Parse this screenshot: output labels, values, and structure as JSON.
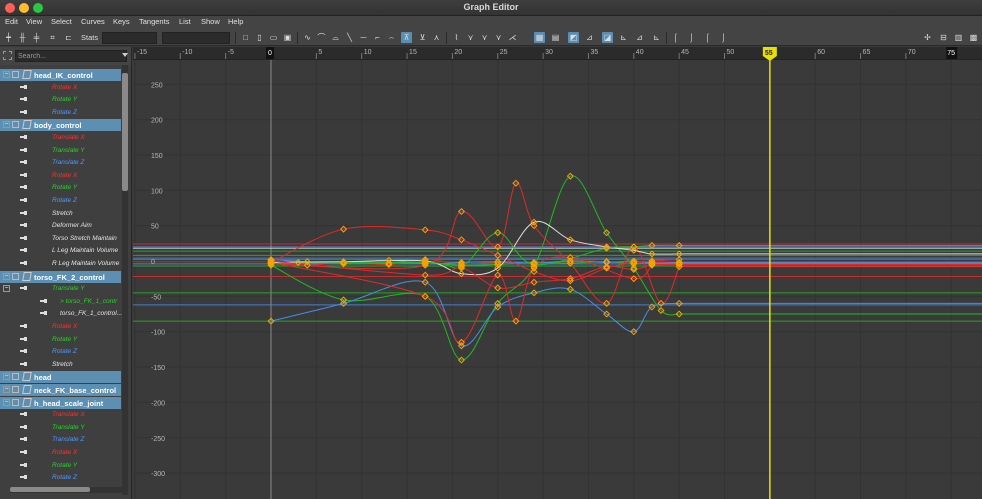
{
  "window": {
    "title": "Graph Editor"
  },
  "menu": [
    "Edit",
    "View",
    "Select",
    "Curves",
    "Keys",
    "Tangents",
    "List",
    "Show",
    "Help"
  ],
  "toolbar": {
    "stats_label": "Stats",
    "stats_value_1": "",
    "stats_value_2": ""
  },
  "outliner": {
    "search_placeholder": "Search...",
    "rows": [
      {
        "type": "node",
        "label": "head_IK_control",
        "selected": true,
        "expanded": true
      },
      {
        "type": "attr",
        "label": "Rotate X",
        "color": "red"
      },
      {
        "type": "attr",
        "label": "Rotate Y",
        "color": "green"
      },
      {
        "type": "attr",
        "label": "Rotate Z",
        "color": "blue"
      },
      {
        "type": "node",
        "label": "body_control",
        "selected": true,
        "expanded": true
      },
      {
        "type": "attr",
        "label": "Translate X",
        "color": "red"
      },
      {
        "type": "attr",
        "label": "Translate Y",
        "color": "green"
      },
      {
        "type": "attr",
        "label": "Translate Z",
        "color": "blue"
      },
      {
        "type": "attr",
        "label": "Rotate X",
        "color": "red"
      },
      {
        "type": "attr",
        "label": "Rotate Y",
        "color": "green"
      },
      {
        "type": "attr",
        "label": "Rotate Z",
        "color": "blue"
      },
      {
        "type": "attr",
        "label": "Stretch",
        "color": "white"
      },
      {
        "type": "attr",
        "label": "Deformer Aim",
        "color": "white"
      },
      {
        "type": "attr",
        "label": "Torso Stretch Maintain",
        "color": "white"
      },
      {
        "type": "attr",
        "label": "L Leg Maintain Volume",
        "color": "white"
      },
      {
        "type": "attr",
        "label": "R Leg Maintain Volume",
        "color": "white"
      },
      {
        "type": "node",
        "label": "torso_FK_2_control",
        "selected": true,
        "expanded": true
      },
      {
        "type": "attr",
        "label": "Translate Y",
        "color": "green",
        "expander": true
      },
      {
        "type": "subattr",
        "label": "> torso_FK_1_contr",
        "color": "green"
      },
      {
        "type": "subattr",
        "label": "torso_FK_1_control...",
        "color": "white"
      },
      {
        "type": "attr",
        "label": "Rotate X",
        "color": "red"
      },
      {
        "type": "attr",
        "label": "Rotate Y",
        "color": "green"
      },
      {
        "type": "attr",
        "label": "Rotate Z",
        "color": "blue"
      },
      {
        "type": "attr",
        "label": "Stretch",
        "color": "white"
      },
      {
        "type": "node",
        "label": "head",
        "selected": true,
        "expanded": true
      },
      {
        "type": "node",
        "label": "neck_FK_base_control",
        "selected": true,
        "expanded": true
      },
      {
        "type": "node",
        "label": "h_head_scale_joint",
        "selected": true,
        "expanded": true
      },
      {
        "type": "attr",
        "label": "Translate X",
        "color": "red"
      },
      {
        "type": "attr",
        "label": "Translate Y",
        "color": "green"
      },
      {
        "type": "attr",
        "label": "Translate Z",
        "color": "blue"
      },
      {
        "type": "attr",
        "label": "Rotate X",
        "color": "red"
      },
      {
        "type": "attr",
        "label": "Rotate Y",
        "color": "green"
      },
      {
        "type": "attr",
        "label": "Rotate Z",
        "color": "blue"
      }
    ]
  },
  "graph": {
    "frame_ticks": [
      "-15",
      "-10",
      "-5",
      "0",
      "5",
      "10",
      "15",
      "20",
      "25",
      "30",
      "35",
      "40",
      "45",
      "50",
      "55",
      "60",
      "65",
      "70",
      "75"
    ],
    "start_frame": "0",
    "current_frame": "55",
    "end_frame": "75",
    "value_ticks": [
      "250",
      "200",
      "150",
      "100",
      "50",
      "0",
      "-50",
      "-100",
      "-150",
      "-200",
      "-250",
      "-300"
    ],
    "curve_colors": {
      "red": "#e02a2a",
      "green": "#22b822",
      "blue": "#4a8ce8",
      "white": "#dddddd",
      "key": "#f5a300",
      "current_time": "#e8e000"
    },
    "curves": [
      {
        "color": "red",
        "keys": [
          [
            0,
            1
          ],
          [
            4,
            -6
          ],
          [
            8,
            -2
          ],
          [
            13,
            -5
          ],
          [
            17,
            2
          ],
          [
            21,
            -4
          ],
          [
            25,
            -2
          ],
          [
            29,
            -4
          ],
          [
            33,
            0
          ],
          [
            37,
            -1
          ],
          [
            40,
            -3
          ],
          [
            42,
            -2
          ],
          [
            45,
            -2
          ]
        ]
      },
      {
        "color": "green",
        "keys": [
          [
            0,
            -3
          ],
          [
            3,
            -2
          ],
          [
            8,
            -4
          ],
          [
            13,
            -3
          ],
          [
            17,
            -3
          ],
          [
            21,
            -6
          ],
          [
            25,
            -5
          ],
          [
            29,
            -2
          ],
          [
            33,
            -3
          ],
          [
            37,
            -1
          ],
          [
            40,
            -4
          ],
          [
            42,
            -3
          ],
          [
            45,
            -3
          ]
        ]
      },
      {
        "color": "blue",
        "keys": [
          [
            0,
            2
          ],
          [
            4,
            -1
          ],
          [
            8,
            -3
          ],
          [
            13,
            1
          ],
          [
            17,
            -4
          ],
          [
            21,
            -2
          ],
          [
            25,
            -1
          ],
          [
            29,
            -3
          ],
          [
            33,
            0
          ],
          [
            37,
            -2
          ],
          [
            40,
            0
          ],
          [
            42,
            -3
          ],
          [
            45,
            -2
          ]
        ]
      },
      {
        "color": "red",
        "keys": [
          [
            0,
            -2
          ],
          [
            8,
            45
          ],
          [
            17,
            44
          ],
          [
            21,
            30
          ],
          [
            25,
            8
          ],
          [
            29,
            -15
          ],
          [
            33,
            -28
          ],
          [
            37,
            -10
          ],
          [
            40,
            -2
          ],
          [
            42,
            0
          ],
          [
            45,
            2
          ]
        ]
      },
      {
        "color": "green",
        "keys": [
          [
            0,
            -6
          ],
          [
            8,
            -55
          ],
          [
            17,
            -50
          ],
          [
            21,
            -140
          ],
          [
            25,
            -60
          ],
          [
            29,
            -8
          ],
          [
            33,
            120
          ],
          [
            37,
            40
          ],
          [
            40,
            -10
          ],
          [
            43,
            -70
          ],
          [
            45,
            -75
          ]
        ]
      },
      {
        "color": "blue",
        "keys": [
          [
            0,
            -85
          ],
          [
            8,
            -60
          ],
          [
            17,
            -30
          ],
          [
            21,
            -120
          ],
          [
            25,
            -65
          ],
          [
            29,
            -45
          ],
          [
            33,
            -40
          ],
          [
            37,
            -75
          ],
          [
            40,
            -100
          ],
          [
            42,
            -65
          ],
          [
            45,
            -60
          ]
        ]
      },
      {
        "color": "red",
        "keys": [
          [
            0,
            -4
          ],
          [
            17,
            -6
          ],
          [
            21,
            70
          ],
          [
            25,
            20
          ],
          [
            27,
            110
          ],
          [
            29,
            50
          ],
          [
            33,
            -3
          ],
          [
            37,
            -60
          ],
          [
            40,
            20
          ],
          [
            43,
            -60
          ],
          [
            45,
            -8
          ]
        ]
      },
      {
        "color": "red",
        "keys": [
          [
            0,
            -2
          ],
          [
            17,
            -50
          ],
          [
            21,
            -115
          ],
          [
            25,
            -20
          ],
          [
            27,
            -85
          ],
          [
            29,
            -10
          ],
          [
            33,
            5
          ],
          [
            40,
            -25
          ],
          [
            42,
            -5
          ]
        ]
      },
      {
        "color": "white",
        "keys": [
          [
            0,
            -2
          ],
          [
            8,
            -1
          ],
          [
            17,
            0
          ],
          [
            21,
            -18
          ],
          [
            25,
            -10
          ],
          [
            29,
            55
          ],
          [
            33,
            30
          ],
          [
            37,
            20
          ],
          [
            40,
            15
          ],
          [
            42,
            10
          ],
          [
            45,
            10
          ]
        ]
      },
      {
        "color": "green",
        "keys": [
          [
            0,
            -4
          ],
          [
            17,
            -2
          ],
          [
            21,
            -8
          ],
          [
            25,
            40
          ],
          [
            29,
            -5
          ],
          [
            37,
            18
          ],
          [
            40,
            20
          ],
          [
            42,
            22
          ],
          [
            45,
            22
          ]
        ]
      },
      {
        "color": "red",
        "keys": [
          [
            0,
            0
          ],
          [
            17,
            -20
          ],
          [
            21,
            -10
          ],
          [
            25,
            -38
          ],
          [
            29,
            -30
          ],
          [
            33,
            -25
          ],
          [
            37,
            -8
          ],
          [
            40,
            -12
          ],
          [
            42,
            -6
          ],
          [
            45,
            -5
          ]
        ]
      }
    ],
    "flat_lines": [
      {
        "color": "green",
        "value": 8
      },
      {
        "color": "blue",
        "value": 4
      },
      {
        "color": "green",
        "value": 2
      },
      {
        "color": "red",
        "value": -1
      },
      {
        "color": "blue",
        "value": -4
      },
      {
        "color": "green",
        "value": -7
      },
      {
        "color": "red",
        "value": 24
      },
      {
        "color": "blue",
        "value": 20
      },
      {
        "color": "white",
        "value": 18
      },
      {
        "color": "green",
        "value": 14
      },
      {
        "color": "red",
        "value": -22
      },
      {
        "color": "green",
        "value": -45
      },
      {
        "color": "blue",
        "value": -62
      },
      {
        "color": "green",
        "value": -85
      }
    ]
  }
}
